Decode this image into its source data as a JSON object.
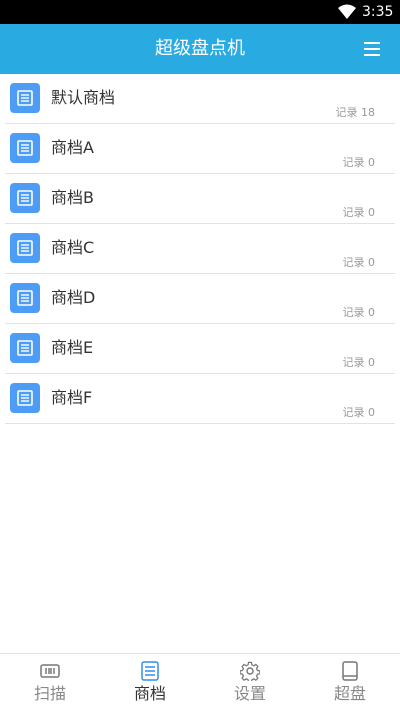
{
  "status_bar": {
    "time": "3:35"
  },
  "app_bar": {
    "title": "超级盘点机",
    "menu_icon": "hamburger-menu-icon"
  },
  "files": [
    {
      "name": "默认商档",
      "count": "记录 18",
      "icon": "document-icon"
    },
    {
      "name": "商档A",
      "count": "记录 0",
      "icon": "document-icon"
    },
    {
      "name": "商档B",
      "count": "记录 0",
      "icon": "document-icon"
    },
    {
      "name": "商档C",
      "count": "记录 0",
      "icon": "document-icon"
    },
    {
      "name": "商档D",
      "count": "记录 0",
      "icon": "document-icon"
    },
    {
      "name": "商档E",
      "count": "记录 0",
      "icon": "document-icon"
    },
    {
      "name": "商档F",
      "count": "记录 0",
      "icon": "document-icon"
    }
  ],
  "bottom_nav": [
    {
      "label": "扫描",
      "icon": "barcode-scan-icon",
      "active": false
    },
    {
      "label": "商档",
      "icon": "file-list-icon",
      "active": true
    },
    {
      "label": "设置",
      "icon": "gear-icon",
      "active": false
    },
    {
      "label": "超盘",
      "icon": "book-icon",
      "active": false
    }
  ],
  "colors": {
    "accent": "#29abe2",
    "icon_bg": "#4d9cf6",
    "active_icon": "#2e8ff0"
  }
}
